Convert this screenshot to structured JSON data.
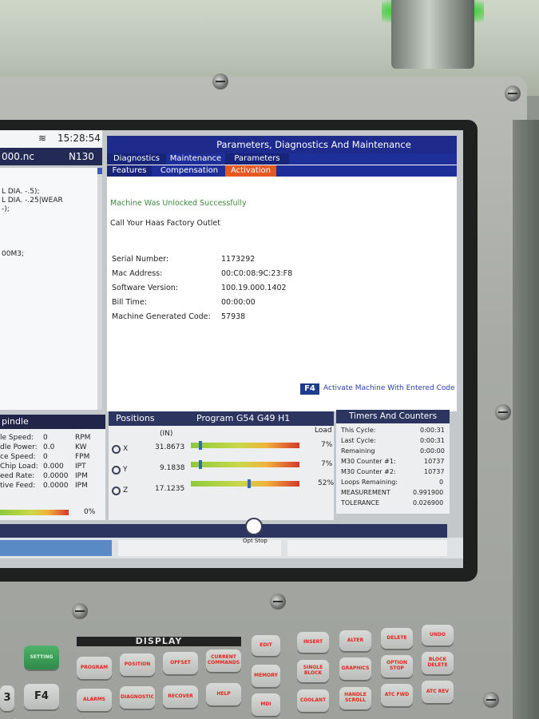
{
  "status": {
    "wifi_icon": "wifi-icon",
    "time": "15:28:54"
  },
  "program": {
    "file_name": "000.nc",
    "block": "N130",
    "code_lines": [
      "L DIA. -.5);",
      "L DIA. -.25|WEAR",
      "-);",
      "00M3;"
    ]
  },
  "params_window": {
    "title": "Parameters, Diagnostics And Maintenance",
    "tabs_top": [
      "Diagnostics",
      "Maintenance",
      "Parameters"
    ],
    "tabs_bottom": [
      "Features",
      "Compensation",
      "Activation"
    ],
    "active_tab": "Activation",
    "success_message": "Machine Was Unlocked Successfully",
    "call_message": "Call Your Haas Factory Outlet",
    "info": [
      {
        "label": "Serial Number:",
        "value": "1173292"
      },
      {
        "label": "Mac Address:",
        "value": "00:C0:08:9C:23:F8"
      },
      {
        "label": "Software Version:",
        "value": "100.19.000.1402"
      },
      {
        "label": "Bill Time:",
        "value": "00:00:00"
      },
      {
        "label": "Machine Generated Code:",
        "value": "57938"
      }
    ],
    "f4_key": "F4",
    "f4_action": "Activate Machine With Entered Code"
  },
  "spindle": {
    "title": "pindle",
    "rows": [
      {
        "label": "le Speed:",
        "value": "0",
        "unit": "RPM"
      },
      {
        "label": "dle Power:",
        "value": "0.0",
        "unit": "KW"
      },
      {
        "label": "ce Speed:",
        "value": "0",
        "unit": "FPM"
      },
      {
        "label": "Chip Load:",
        "value": "0.000",
        "unit": "IPT"
      },
      {
        "label": "eed Rate:",
        "value": "0.0000",
        "unit": "IPM"
      },
      {
        "label": "tive Feed:",
        "value": "0.0000",
        "unit": "IPM"
      }
    ],
    "load_percent": "0%",
    "load_fraction": 0.0
  },
  "positions": {
    "title": "Positions",
    "program_title": "Program G54 G49 H1",
    "unit_label": "(IN)",
    "load_label": "Load",
    "axes": [
      {
        "axis": "X",
        "value": "31.8673",
        "load": "7%",
        "load_fraction": 0.07
      },
      {
        "axis": "Y",
        "value": "9.1838",
        "load": "7%",
        "load_fraction": 0.07
      },
      {
        "axis": "Z",
        "value": "17.1235",
        "load": "52%",
        "load_fraction": 0.52
      }
    ]
  },
  "timers": {
    "title": "Timers And Counters",
    "rows": [
      {
        "label": "This Cycle:",
        "value": "0:00:31"
      },
      {
        "label": "Last Cycle:",
        "value": "0:00:31"
      },
      {
        "label": "Remaining",
        "value": "0:00:00"
      },
      {
        "label": "M30 Counter #1:",
        "value": "10737"
      },
      {
        "label": "M30 Counter #2:",
        "value": "10737"
      },
      {
        "label": "Loops Remaining:",
        "value": "0"
      },
      {
        "label": "MEASUREMENT",
        "value": "0.991900"
      },
      {
        "label": "TOLERANCE",
        "value": "0.026900"
      }
    ]
  },
  "opt_stop": {
    "label": "Opt Stop"
  },
  "keypad": {
    "display_label": "DISPLAY",
    "keys": [
      "PROGRAM",
      "POSITION",
      "OFFSET",
      "CURRENT COMMANDS",
      "EDIT",
      "INSERT",
      "ALTER",
      "DELETE",
      "UNDO",
      "SETTING",
      "HELP",
      "MEMORY",
      "SINGLE BLOCK",
      "GRAPHICS",
      "OPTION STOP",
      "BLOCK DELETE",
      "ALARMS",
      "DIAGNOSTIC",
      "MDI",
      "COOLANT",
      "HANDLE SCROLL",
      "ATC FWD",
      "ATC REV",
      "RECOVER",
      "F4",
      "3"
    ]
  }
}
